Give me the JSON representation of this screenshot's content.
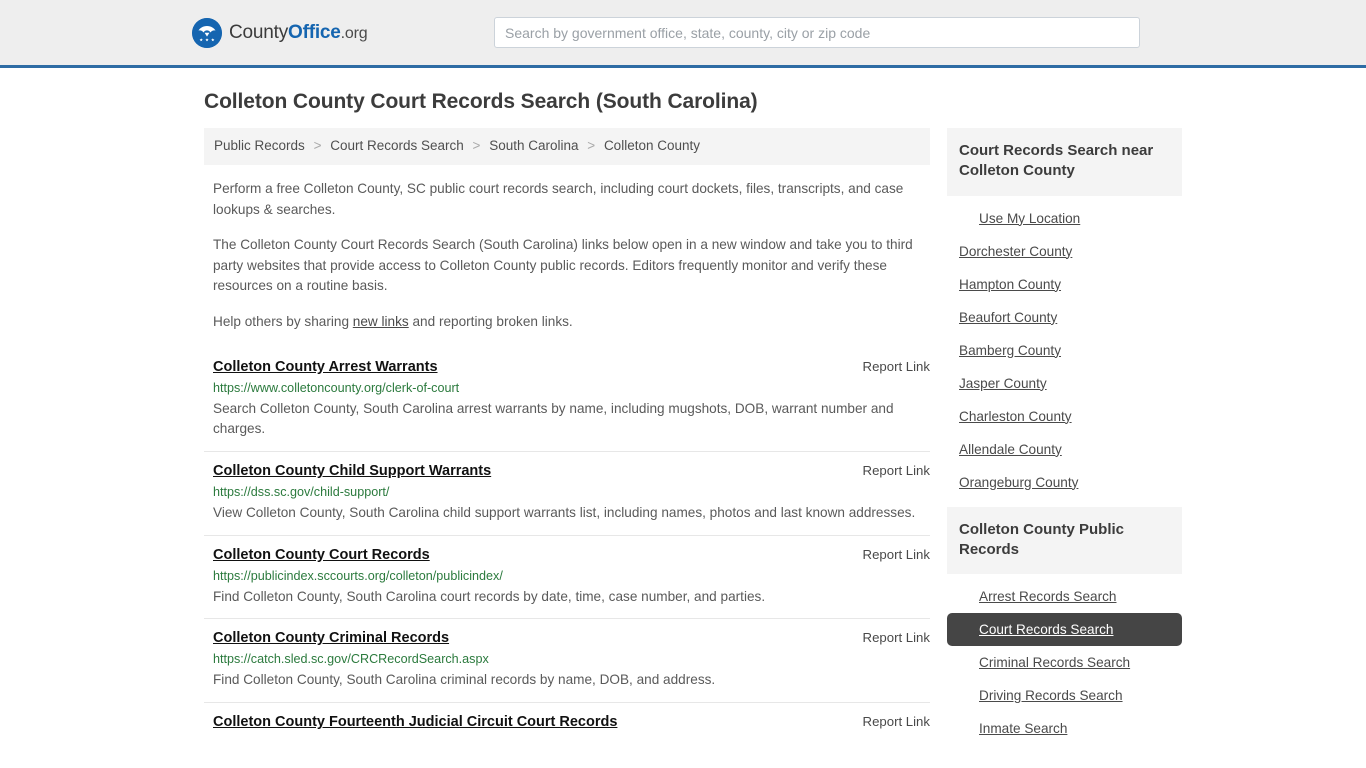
{
  "header": {
    "logo": {
      "icon": "eagle-shield-logo-icon",
      "text_county": "County",
      "text_office": "Office",
      "text_org": ".org"
    },
    "search": {
      "placeholder": "Search by government office, state, county, city or zip code",
      "value": ""
    },
    "accent_color": "#2e6ca4"
  },
  "page_title": "Colleton County Court Records Search (South Carolina)",
  "breadcrumb": {
    "separator": ">",
    "items": [
      {
        "label": "Public Records"
      },
      {
        "label": "Court Records Search"
      },
      {
        "label": "South Carolina"
      },
      {
        "label": "Colleton County"
      }
    ]
  },
  "intro": {
    "p1": "Perform a free Colleton County, SC public court records search, including court dockets, files, transcripts, and case lookups & searches.",
    "p2": "The Colleton County Court Records Search (South Carolina) links below open in a new window and take you to third party websites that provide access to Colleton County public records. Editors frequently monitor and verify these resources on a routine basis.",
    "p3_before": "Help others by sharing ",
    "p3_link": "new links",
    "p3_after": " and reporting broken links."
  },
  "results": {
    "report_link_label": "Report Link",
    "items": [
      {
        "title": "Colleton County Arrest Warrants",
        "url": "https://www.colletoncounty.org/clerk-of-court",
        "description": "Search Colleton County, South Carolina arrest warrants by name, including mugshots, DOB, warrant number and charges."
      },
      {
        "title": "Colleton County Child Support Warrants",
        "url": "https://dss.sc.gov/child-support/",
        "description": "View Colleton County, South Carolina child support warrants list, including names, photos and last known addresses."
      },
      {
        "title": "Colleton County Court Records",
        "url": "https://publicindex.sccourts.org/colleton/publicindex/",
        "description": "Find Colleton County, South Carolina court records by date, time, case number, and parties."
      },
      {
        "title": "Colleton County Criminal Records",
        "url": "https://catch.sled.sc.gov/CRCRecordSearch.aspx",
        "description": "Find Colleton County, South Carolina criminal records by name, DOB, and address."
      },
      {
        "title": "Colleton County Fourteenth Judicial Circuit Court Records",
        "url": "",
        "description": ""
      }
    ]
  },
  "sidebar": {
    "nearby_panel": {
      "title": "Court Records Search near Colleton County",
      "items": [
        {
          "label": "Use My Location",
          "indent": true,
          "active": false
        },
        {
          "label": "Dorchester County",
          "indent": false,
          "active": false
        },
        {
          "label": "Hampton County",
          "indent": false,
          "active": false
        },
        {
          "label": "Beaufort County",
          "indent": false,
          "active": false
        },
        {
          "label": "Bamberg County",
          "indent": false,
          "active": false
        },
        {
          "label": "Jasper County",
          "indent": false,
          "active": false
        },
        {
          "label": "Charleston County",
          "indent": false,
          "active": false
        },
        {
          "label": "Allendale County",
          "indent": false,
          "active": false
        },
        {
          "label": "Orangeburg County",
          "indent": false,
          "active": false
        }
      ]
    },
    "public_records_panel": {
      "title": "Colleton County Public Records",
      "items": [
        {
          "label": "Arrest Records Search",
          "indent": true,
          "active": false
        },
        {
          "label": "Court Records Search",
          "indent": true,
          "active": true
        },
        {
          "label": "Criminal Records Search",
          "indent": true,
          "active": false
        },
        {
          "label": "Driving Records Search",
          "indent": true,
          "active": false
        },
        {
          "label": "Inmate Search",
          "indent": true,
          "active": false
        }
      ]
    }
  }
}
